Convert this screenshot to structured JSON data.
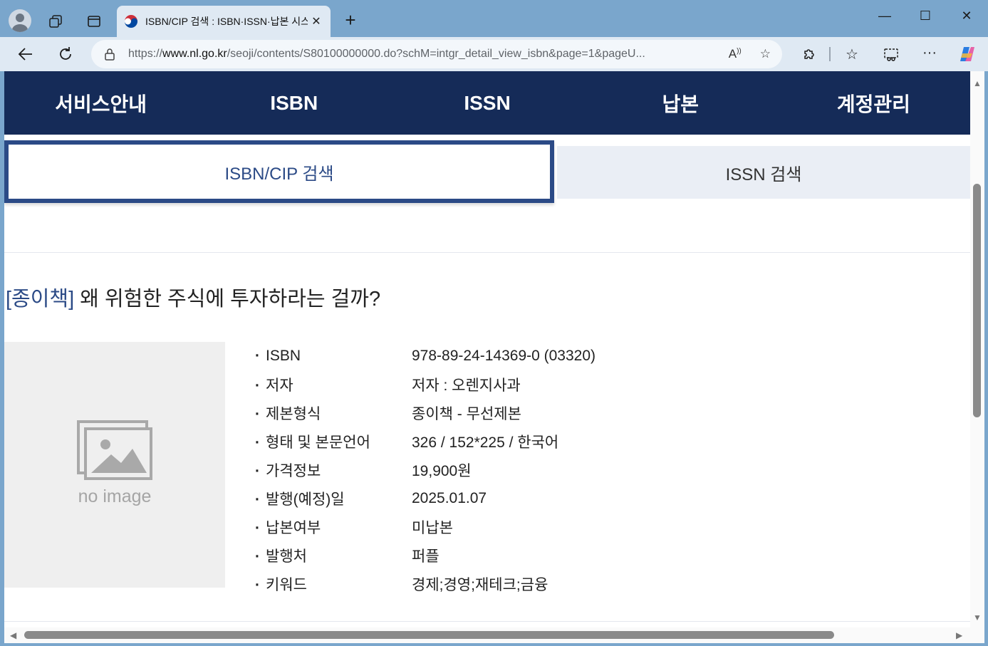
{
  "browser": {
    "tab_title": "ISBN/CIP 검색 : ISBN·ISSN·납본 시스템",
    "new_tab": "+",
    "url_prefix": "https://",
    "url_host": "www.nl.go.kr",
    "url_path": "/seoji/contents/S80100000000.do?schM=intgr_detail_view_isbn&page=1&pageU...",
    "minimize": "—",
    "maximize": "☐",
    "close": "✕"
  },
  "top_menu": [
    "서비스안내",
    "ISBN",
    "ISSN",
    "납본",
    "계정관리"
  ],
  "sub_tabs": {
    "active": "ISBN/CIP 검색",
    "inactive": "ISSN 검색"
  },
  "book": {
    "kind": "[종이책]",
    "title": "왜 위험한 주식에 투자하라는 걸까?",
    "cover_text": "no image",
    "fields": [
      {
        "label": "ISBN",
        "value": "978-89-24-14369-0 (03320)"
      },
      {
        "label": "저자",
        "value": "저자 : 오렌지사과"
      },
      {
        "label": "제본형식",
        "value": "종이책 - 무선제본"
      },
      {
        "label": "형태 및 본문언어",
        "value": "326 / 152*225 / 한국어"
      },
      {
        "label": "가격정보",
        "value": "19,900원"
      },
      {
        "label": "발행(예정)일",
        "value": "2025.01.07"
      },
      {
        "label": "납본여부",
        "value": "미납본"
      },
      {
        "label": "발행처",
        "value": "퍼플"
      },
      {
        "label": "키워드",
        "value": "경제;경영;재테크;금융"
      }
    ]
  }
}
